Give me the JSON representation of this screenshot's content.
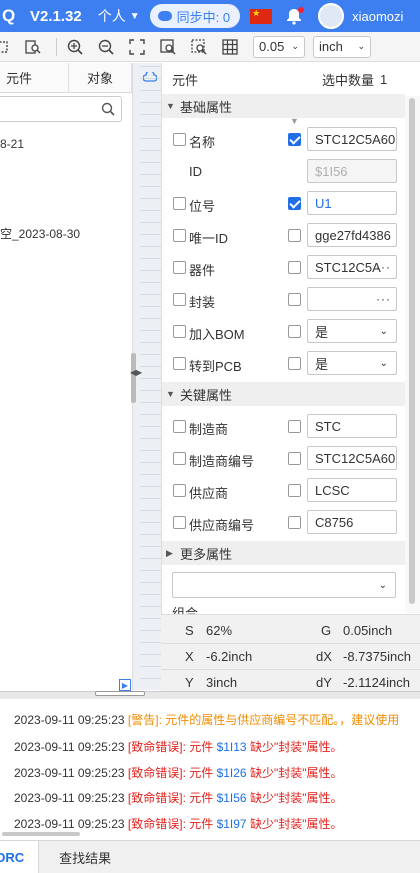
{
  "topbar": {
    "version": "V2.1.32",
    "user_menu": "个人",
    "sync_status": "同步中: 0",
    "username": "xiaomozi"
  },
  "toolbar": {
    "zoom_value": "0.05",
    "unit_value": "inch"
  },
  "left_panel": {
    "tabs": [
      "元件",
      "对象"
    ],
    "search_placeholder": "",
    "items": [
      "8-21",
      "空_2023-08-30"
    ]
  },
  "properties": {
    "header_title": "元件",
    "selection_count_label": "选中数量",
    "selection_count": "1",
    "sections": {
      "basic": "基础属性",
      "key": "关键属性",
      "more": "更多属性",
      "group": "组合"
    },
    "basic_rows": [
      {
        "label": "名称",
        "checked": true,
        "value": "STC12C5A60"
      },
      {
        "label": "ID",
        "value": "$1I56"
      },
      {
        "label": "位号",
        "checked": true,
        "value": "U1"
      },
      {
        "label": "唯一ID",
        "checked": false,
        "value": "gge27fd4386"
      },
      {
        "label": "器件",
        "checked": false,
        "value": "STC12C5A"
      },
      {
        "label": "封装",
        "checked": false,
        "value": ""
      },
      {
        "label": "加入BOM",
        "checked": false,
        "value": "是"
      },
      {
        "label": "转到PCB",
        "checked": false,
        "value": "是"
      }
    ],
    "key_rows": [
      {
        "label": "制造商",
        "checked": false,
        "value": "STC"
      },
      {
        "label": "制造商编号",
        "checked": false,
        "value": "STC12C5A60"
      },
      {
        "label": "供应商",
        "checked": false,
        "value": "LCSC"
      },
      {
        "label": "供应商编号",
        "checked": false,
        "value": "C8756"
      }
    ],
    "more_select_value": ""
  },
  "stats": {
    "s_label": "S",
    "s_value": "62%",
    "g_label": "G",
    "g_value": "0.05inch",
    "x_label": "X",
    "x_value": "-6.2inch",
    "dx_label": "dX",
    "dx_value": "-8.7375inch",
    "y_label": "Y",
    "y_value": "3inch",
    "dy_label": "dY",
    "dy_value": "-2.1124inch"
  },
  "log": [
    {
      "time": "2023-09-11 09:25:23",
      "tag": "[警告]",
      "msg": ": 元件的属性与供应商编号不匹配。，建议使用",
      "ref": "",
      "tail": ""
    },
    {
      "time": "2023-09-11 09:25:23",
      "tag": "[致命错误]",
      "msg": ": 元件",
      "ref": "$1I13",
      "tail": "缺少\"封装\"属性。"
    },
    {
      "time": "2023-09-11 09:25:23",
      "tag": "[致命错误]",
      "msg": ": 元件",
      "ref": "$1I26",
      "tail": "缺少\"封装\"属性。"
    },
    {
      "time": "2023-09-11 09:25:23",
      "tag": "[致命错误]",
      "msg": ": 元件",
      "ref": "$1I56",
      "tail": "缺少\"封装\"属性。"
    },
    {
      "time": "2023-09-11 09:25:23",
      "tag": "[致命错误]",
      "msg": ": 元件",
      "ref": "$1I97",
      "tail": "缺少\"封装\"属性。"
    }
  ],
  "bottom_tabs": [
    "DRC",
    "查找结果"
  ],
  "colors": {
    "topbar": "#3d7ff0",
    "accent": "#1e6fe8",
    "warning": "#f08c00",
    "error": "#e3211c"
  }
}
